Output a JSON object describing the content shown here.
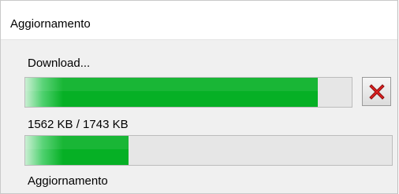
{
  "window": {
    "title": "Aggiornamento"
  },
  "download": {
    "label": "Download...",
    "progress": 0.8962,
    "transferred": "1562 KB / 1743 KB",
    "cancel_icon": "red-x-icon"
  },
  "update": {
    "label": "Aggiornamento",
    "progress": 0.2814
  },
  "colors": {
    "progress_fill": "#06b025",
    "progress_track": "#e6e6e6",
    "cancel_x": "#e02020"
  }
}
